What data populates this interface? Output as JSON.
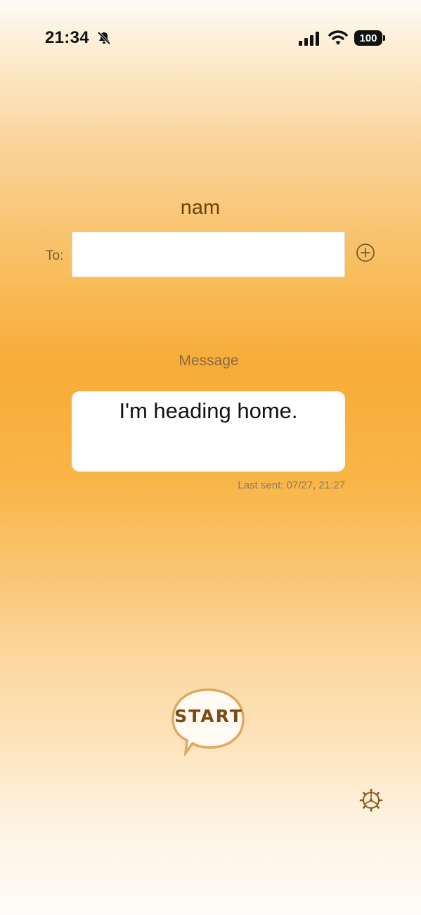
{
  "status_bar": {
    "time": "21:34",
    "battery_level": "100",
    "icons": [
      "bell-slash-icon",
      "cellular-signal-icon",
      "wifi-icon",
      "battery-icon"
    ]
  },
  "recipient": {
    "name": "nam",
    "to_label": "To:",
    "to_value": ""
  },
  "message": {
    "label": "Message",
    "text": "I'm heading home.",
    "last_sent": "Last sent: 07/27, 21:27"
  },
  "start": {
    "label": "START"
  },
  "colors": {
    "accent": "#f7ac38",
    "brown": "#6b4210",
    "label": "#8a6b44"
  }
}
